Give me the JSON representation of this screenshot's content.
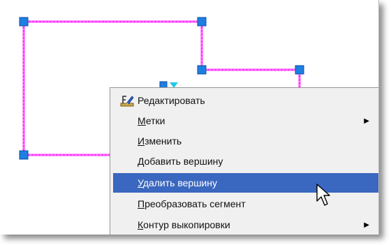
{
  "colors": {
    "path": "#ff33ff",
    "vertex": "#1e7fe0",
    "selection": "#3a67bf",
    "menu_bg": "#f0f0f0"
  },
  "context_menu": {
    "items": [
      {
        "label_before": "",
        "label_underlined": "",
        "label_after": "Редактировать",
        "icon": "edit-polyline-icon",
        "has_submenu": false,
        "selected": false
      },
      {
        "label_before": "",
        "label_underlined": "М",
        "label_after": "етки",
        "icon": "",
        "has_submenu": true,
        "selected": false
      },
      {
        "label_before": "",
        "label_underlined": "И",
        "label_after": "зменить",
        "icon": "",
        "has_submenu": false,
        "selected": false
      },
      {
        "label_before": "",
        "label_underlined": "Д",
        "label_after": "обавить вершину",
        "icon": "",
        "has_submenu": false,
        "selected": false
      },
      {
        "label_before": "",
        "label_underlined": "У",
        "label_after": "далить вершину",
        "icon": "",
        "has_submenu": false,
        "selected": true
      },
      {
        "label_before": "",
        "label_underlined": "П",
        "label_after": "реобразовать сегмент",
        "icon": "",
        "has_submenu": false,
        "selected": false
      },
      {
        "label_before": "",
        "label_underlined": "К",
        "label_after": "онтур выкопировки",
        "icon": "",
        "has_submenu": true,
        "selected": false
      }
    ]
  }
}
